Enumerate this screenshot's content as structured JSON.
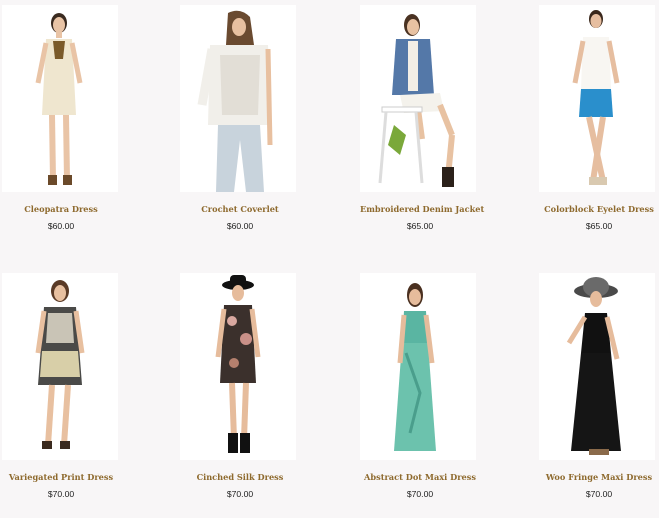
{
  "products": [
    {
      "name": "Cleopatra Dress",
      "price": "$60.00",
      "image": "model-cream-dress"
    },
    {
      "name": "Crochet Coverlet",
      "price": "$60.00",
      "image": "model-white-crochet-top"
    },
    {
      "name": "Embroidered Denim Jacket",
      "price": "$65.00",
      "image": "model-denim-jacket-stool"
    },
    {
      "name": "Colorblock Eyelet Dress",
      "price": "$65.00",
      "image": "model-white-blue-dress"
    },
    {
      "name": "Variegated Print Dress",
      "price": "$70.00",
      "image": "model-print-dress"
    },
    {
      "name": "Cinched Silk Dress",
      "price": "$70.00",
      "image": "model-floral-silk-dress-hat"
    },
    {
      "name": "Abstract Dot Maxi Dress",
      "price": "$70.00",
      "image": "model-teal-maxi-dress"
    },
    {
      "name": "Woo Fringe Maxi Dress",
      "price": "$70.00",
      "image": "model-black-maxi-dress-hat"
    }
  ],
  "colors": {
    "background": "#f8f6f7",
    "product_name": "#8e6a2e",
    "price": "#222222"
  }
}
